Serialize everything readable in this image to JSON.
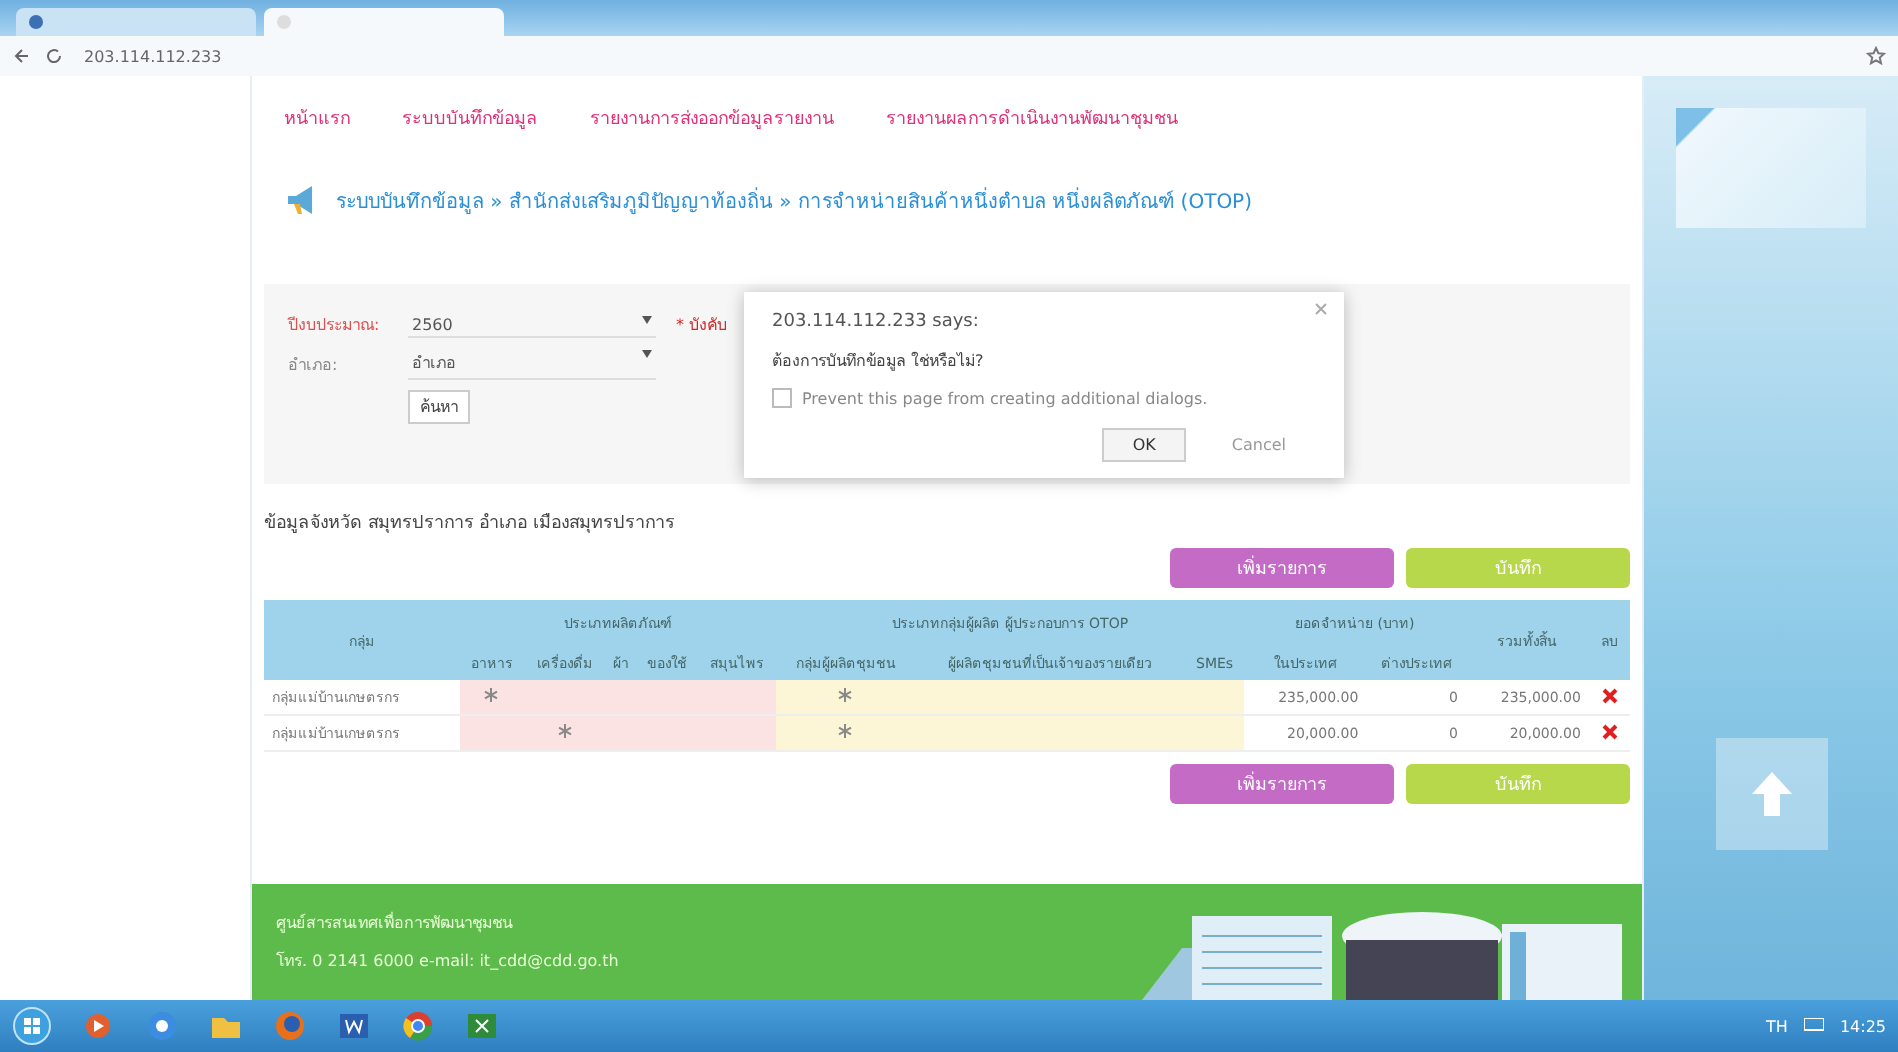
{
  "browser": {
    "tabs": [
      {
        "selected": false
      },
      {
        "selected": true
      }
    ],
    "address": "203.114.112.233"
  },
  "nav": [
    "หน้าแรก",
    "ระบบบันทึกข้อมูล",
    "รายงานการส่งออกข้อมูลรายงาน",
    "รายงานผลการดำเนินงานพัฒนาชุมชน"
  ],
  "breadcrumb": "ระบบบันทึกข้อมูล » สำนักส่งเสริมภูมิปัญญาท้องถิ่น » การจำหน่ายสินค้าหนึ่งตำบล หนึ่งผลิตภัณฑ์ (OTOP)",
  "form": {
    "year_label": "ปีงบประมาณ:",
    "year": "2560",
    "required": "* บังคับ",
    "area_label": "อำเภอ:",
    "area": "อำเภอ",
    "search_button": "ค้นหา"
  },
  "section_title": "ข้อมูลจังหวัด สมุทรปราการ อำเภอ เมืองสมุทรปราการ",
  "actions_top": [
    {
      "kind": "add",
      "label": "เพิ่มรายการ"
    },
    {
      "kind": "save",
      "label": "บันทึก"
    }
  ],
  "actions_bottom": [
    {
      "kind": "add",
      "label": "เพิ่มรายการ"
    },
    {
      "kind": "save",
      "label": "บันทึก"
    }
  ],
  "table": {
    "name_header": "กลุ่ม",
    "groups": [
      {
        "kind": "product",
        "label": "ประเภทผลิตภัณฑ์",
        "columns": [
          "อาหาร",
          "เครื่องดื่ม",
          "ผ้า",
          "ของใช้",
          "สมุนไพร"
        ]
      },
      {
        "kind": "producer",
        "label": "ประเภทกลุ่มผู้ผลิต ผู้ประกอบการ OTOP",
        "columns": [
          "กลุ่มผู้ผลิตชุมชน",
          "ผู้ผลิตชุมชนที่เป็นเจ้าของรายเดียว",
          "SMEs"
        ]
      },
      {
        "kind": "sales",
        "label": "ยอดจำหน่าย (บาท)",
        "columns": [
          "ในประเทศ",
          "ต่างประเทศ"
        ]
      }
    ],
    "total_header": "รวมทั้งสิ้น",
    "delete_header": "ลบ",
    "rows": [
      {
        "name": "กลุ่มแม่บ้านเกษตรกร",
        "product": [
          true,
          false,
          false,
          false,
          false
        ],
        "producer": [
          true,
          false,
          false
        ],
        "domestic": "235,000.00",
        "foreign": "0",
        "total": "235,000.00"
      },
      {
        "name": "กลุ่มแม่บ้านเกษตรกร",
        "product": [
          false,
          true,
          false,
          false,
          false
        ],
        "producer": [
          true,
          false,
          false
        ],
        "domestic": "20,000.00",
        "foreign": "0",
        "total": "20,000.00"
      }
    ]
  },
  "footer": {
    "title": "ศูนย์สารสนเทศเพื่อการพัฒนาชุมชน",
    "contact": "โทร. 0 2141 6000 e-mail: it_cdd@cdd.go.th"
  },
  "dialog": {
    "title": "203.114.112.233 says:",
    "message": "ต้องการบันทึกข้อมูล ใช่หรือไม่?",
    "prevent_label": "Prevent this page from creating additional dialogs.",
    "prevent_checked": false,
    "ok": "OK",
    "cancel": "Cancel"
  },
  "taskbar": {
    "apps": [
      {
        "kind": "media"
      },
      {
        "kind": "chrome-old"
      },
      {
        "kind": "folder"
      },
      {
        "kind": "firefox"
      },
      {
        "kind": "word"
      },
      {
        "kind": "chrome"
      },
      {
        "kind": "excel"
      }
    ],
    "language": "TH",
    "time": "14:25"
  }
}
